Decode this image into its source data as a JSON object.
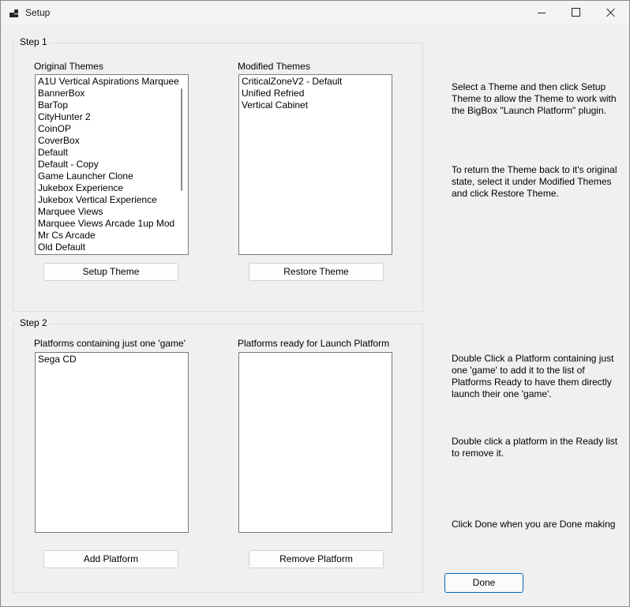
{
  "window": {
    "title": "Setup"
  },
  "step1": {
    "label": "Step 1",
    "original_label": "Original Themes",
    "original_items": [
      "A1U Vertical Aspirations Marquee",
      "BannerBox",
      "BarTop",
      "CityHunter 2",
      "CoinOP",
      "CoverBox",
      "Default",
      "Default - Copy",
      "Game Launcher Clone",
      "Jukebox Experience",
      "Jukebox Vertical Experience",
      "Marquee Views",
      "Marquee Views Arcade 1up Mod",
      "Mr Cs Arcade",
      "Old Default"
    ],
    "modified_label": "Modified Themes",
    "modified_items": [
      "CriticalZoneV2 - Default",
      "Unified Refried",
      "Vertical Cabinet"
    ],
    "setup_button": "Setup Theme",
    "restore_button": "Restore Theme"
  },
  "step2": {
    "label": "Step 2",
    "single_label": "Platforms containing just one 'game'",
    "single_items": [
      "Sega CD"
    ],
    "ready_label": "Platforms ready for Launch Platform",
    "ready_items": [],
    "add_button": "Add Platform",
    "remove_button": "Remove Platform"
  },
  "help": {
    "setup": "Select a Theme and then click Setup Theme to allow the Theme to work with the BigBox \"Launch Platform\" plugin.",
    "restore": "To return the Theme back to it's original state, select it under Modified Themes and click Restore Theme.",
    "double_click": "Double Click a Platform containing just one 'game' to add it to the list of Platforms Ready to have them directly launch their one 'game'.",
    "remove": "Double click a platform in the Ready list to remove it.",
    "done": "Click Done when you are Done making"
  },
  "done_button": "Done"
}
